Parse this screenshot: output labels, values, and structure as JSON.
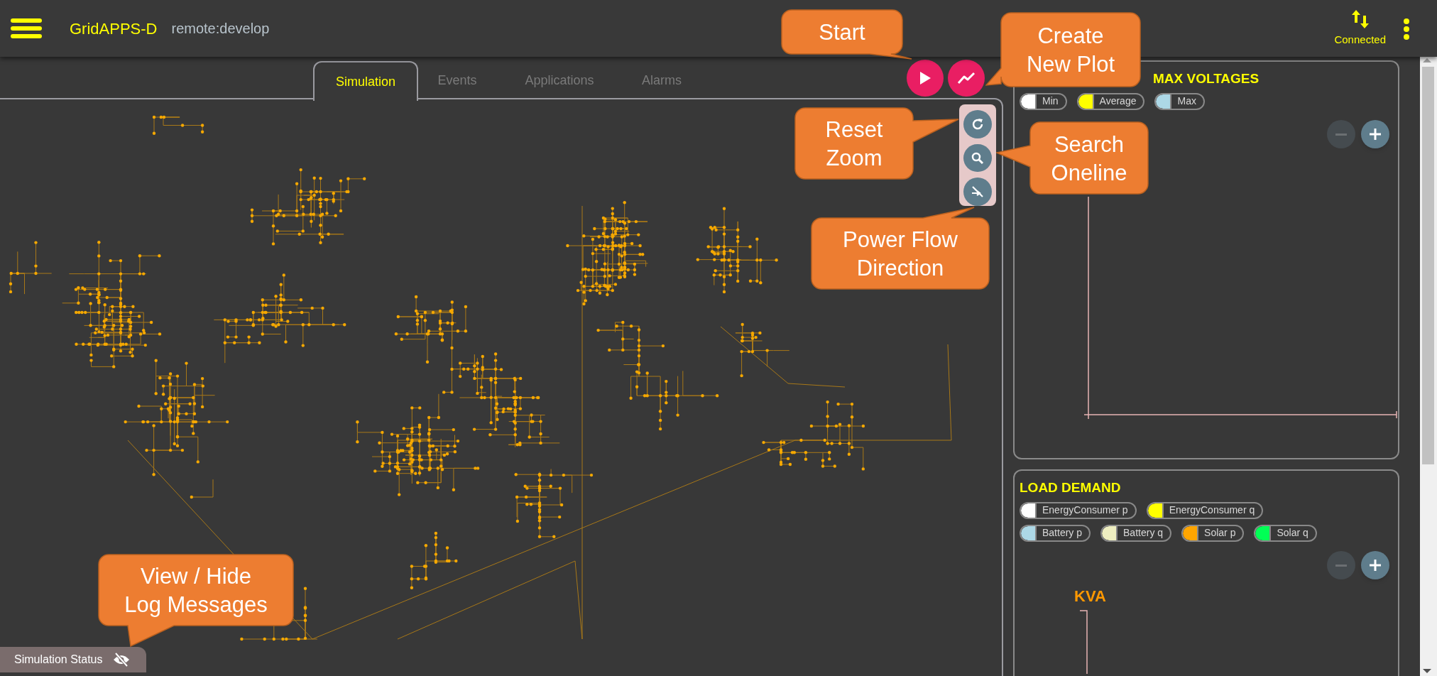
{
  "app_bar": {
    "title": "GridAPPS-D",
    "source": "remote:develop",
    "connection_status": "Connected"
  },
  "tabs": [
    {
      "label": "Simulation",
      "selected": true
    },
    {
      "label": "Events",
      "selected": false
    },
    {
      "label": "Applications",
      "selected": false
    },
    {
      "label": "Alarms",
      "selected": false
    }
  ],
  "plots": [
    {
      "title": "MAX VOLTAGES",
      "zoom_out_disabled": true,
      "legend": [
        {
          "label": "Min",
          "color": "#ffffff"
        },
        {
          "label": "Average",
          "color": "#ffff00"
        },
        {
          "label": "Max",
          "color": "#add8e6"
        }
      ]
    },
    {
      "title": "LOAD DEMAND",
      "zoom_out_disabled": true,
      "y_axis_label": "KVA",
      "legend": [
        {
          "label": "EnergyConsumer p",
          "color": "#ffffff"
        },
        {
          "label": "EnergyConsumer q",
          "color": "#ffff00"
        },
        {
          "label": "Battery p",
          "color": "#add8e6"
        },
        {
          "label": "Battery q",
          "color": "#eeeec0"
        },
        {
          "label": "Solar p",
          "color": "#ffa500"
        },
        {
          "label": "Solar q",
          "color": "#00ff55"
        }
      ]
    }
  ],
  "status_bar": {
    "label": "Simulation Status"
  },
  "callouts": [
    {
      "lines": [
        "Start"
      ]
    },
    {
      "lines": [
        "Create",
        "New Plot"
      ]
    },
    {
      "lines": [
        "Reset",
        "Zoom"
      ]
    },
    {
      "lines": [
        "Search",
        "Oneline"
      ]
    },
    {
      "lines": [
        "Power Flow",
        "Direction"
      ]
    },
    {
      "lines": [
        "View / Hide",
        "Log Messages"
      ]
    }
  ]
}
